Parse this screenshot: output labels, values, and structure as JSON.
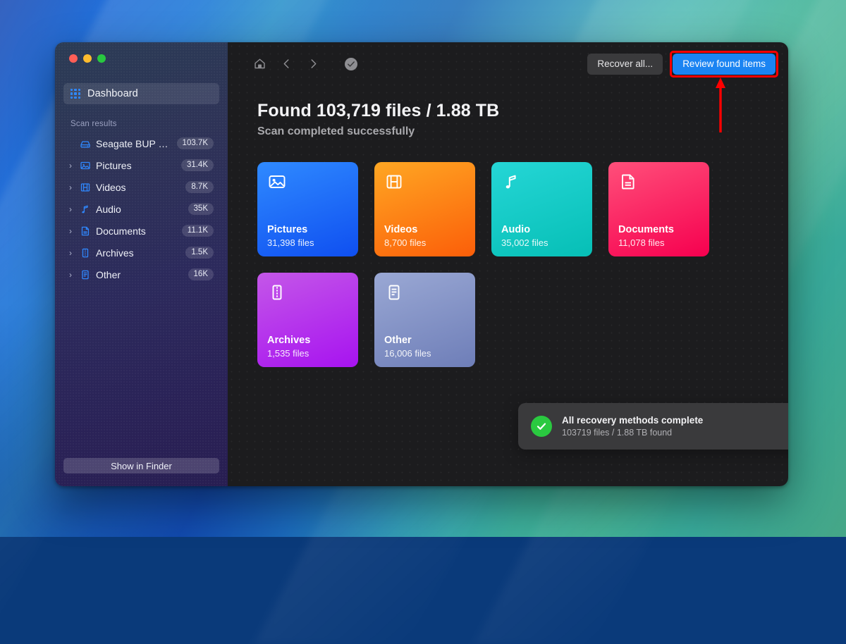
{
  "window": {
    "traffic_lights": [
      "close",
      "minimize",
      "maximize"
    ]
  },
  "sidebar": {
    "dashboard": {
      "label": "Dashboard",
      "icon": "grid-icon"
    },
    "section_label": "Scan results",
    "items": [
      {
        "label": "Seagate BUP S...",
        "badge": "103.7K",
        "icon": "hard-drive-icon",
        "expandable": false
      },
      {
        "label": "Pictures",
        "badge": "31.4K",
        "icon": "picture-icon",
        "expandable": true
      },
      {
        "label": "Videos",
        "badge": "8.7K",
        "icon": "film-icon",
        "expandable": true
      },
      {
        "label": "Audio",
        "badge": "35K",
        "icon": "music-note-icon",
        "expandable": true
      },
      {
        "label": "Documents",
        "badge": "11.1K",
        "icon": "document-icon",
        "expandable": true
      },
      {
        "label": "Archives",
        "badge": "1.5K",
        "icon": "archive-icon",
        "expandable": true
      },
      {
        "label": "Other",
        "badge": "16K",
        "icon": "list-doc-icon",
        "expandable": true
      }
    ],
    "footer_button": "Show in Finder"
  },
  "toolbar": {
    "home_icon": "home-icon",
    "back_icon": "chevron-left-icon",
    "forward_icon": "chevron-right-icon",
    "status_icon": "check-circle-icon",
    "recover_all_label": "Recover all...",
    "review_label": "Review found items",
    "primary_color": "#1b84f2",
    "highlight_color": "#ff0000"
  },
  "headline": {
    "title": "Found 103,719 files / 1.88 TB",
    "subtitle": "Scan completed successfully"
  },
  "cards": [
    {
      "title": "Pictures",
      "count": "31,398 files",
      "icon": "picture-icon",
      "color_from": "#2f8aff",
      "color_to": "#0f4ff0"
    },
    {
      "title": "Videos",
      "count": "8,700 files",
      "icon": "film-icon",
      "color_from": "#ffa723",
      "color_to": "#fb5e09"
    },
    {
      "title": "Audio",
      "count": "35,002 files",
      "icon": "music-note-icon",
      "color_from": "#25d6d6",
      "color_to": "#06bfb6"
    },
    {
      "title": "Documents",
      "count": "11,078 files",
      "icon": "document-icon",
      "color_from": "#ff4f7a",
      "color_to": "#f6004f"
    },
    {
      "title": "Archives",
      "count": "1,535 files",
      "icon": "archive-icon",
      "color_from": "#c457e8",
      "color_to": "#a713f0"
    },
    {
      "title": "Other",
      "count": "16,006 files",
      "icon": "list-doc-icon",
      "color_from": "#9aa8d4",
      "color_to": "#6e7eb8"
    }
  ],
  "toast": {
    "title": "All recovery methods complete",
    "subtitle": "103719 files / 1.88 TB found",
    "status_icon": "check-circle-filled-icon",
    "close_icon": "close-icon",
    "accent_color": "#2ac940"
  }
}
